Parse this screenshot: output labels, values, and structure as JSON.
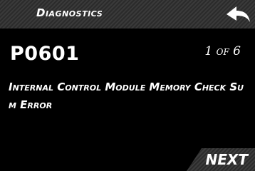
{
  "header": {
    "title": "Diagnostics",
    "back_icon": "back-arrow-icon"
  },
  "dtc": {
    "code": "P0601",
    "pager": "1 of 6",
    "description": "Internal Control Module Memory Check Sum Error"
  },
  "footer": {
    "next_label": "NEXT"
  },
  "colors": {
    "background": "#000000",
    "text": "#ffffff",
    "bar": "#333333"
  }
}
